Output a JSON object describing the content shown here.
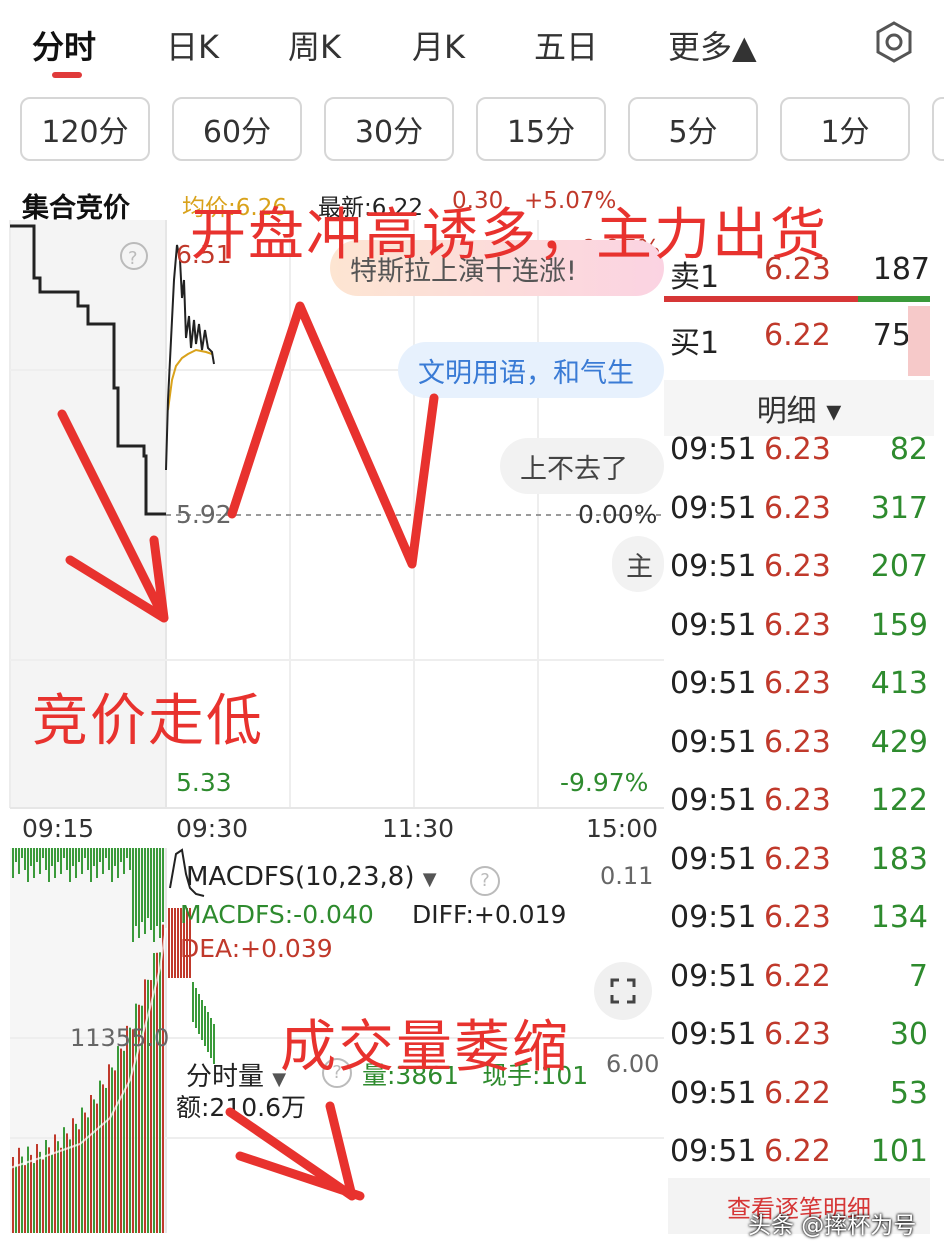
{
  "tabs": [
    "分时",
    "日K",
    "周K",
    "月K",
    "五日",
    "更多▲"
  ],
  "periods": [
    "120分",
    "60分",
    "30分",
    "15分",
    "5分",
    "1分"
  ],
  "header": {
    "auction_label": "集合竞价",
    "avg": "均价:6.26",
    "latest": "最新:6.22",
    "change": "0.30",
    "change_pct": "+5.07%"
  },
  "chart": {
    "high_price": "6.51",
    "high_pct": "+9.97%",
    "base_price": "5.92",
    "base_pct": "0.00%",
    "low_price": "5.33",
    "low_pct": "-9.97%",
    "times": [
      "09:15",
      "09:30",
      "11:30",
      "15:00"
    ]
  },
  "bubbles": [
    "特斯拉上演十连涨!",
    "文明用语，和气生",
    "上不去了",
    "主"
  ],
  "macd": {
    "title": "MACDFS(10,23,8)",
    "macdfs": "MACDFS:-0.040",
    "diff": "DIFF:+0.019",
    "dea": "DEA:+0.039",
    "right_value": "0.11"
  },
  "volume": {
    "title": "分时量",
    "volume": "量:3861",
    "hand": "现手:101",
    "amount": "额:210.6万",
    "left_value": "11355.0",
    "right_value": "6.00"
  },
  "orderbook": {
    "sell1": {
      "label": "卖1",
      "price": "6.23",
      "vol": "187"
    },
    "buy1": {
      "label": "买1",
      "price": "6.22",
      "vol": "751"
    }
  },
  "detail_title": "明细 ▾",
  "trades": [
    {
      "t": "09:51",
      "p": "6.23",
      "v": "82"
    },
    {
      "t": "09:51",
      "p": "6.23",
      "v": "317"
    },
    {
      "t": "09:51",
      "p": "6.23",
      "v": "207"
    },
    {
      "t": "09:51",
      "p": "6.23",
      "v": "159"
    },
    {
      "t": "09:51",
      "p": "6.23",
      "v": "413"
    },
    {
      "t": "09:51",
      "p": "6.23",
      "v": "429"
    },
    {
      "t": "09:51",
      "p": "6.23",
      "v": "122"
    },
    {
      "t": "09:51",
      "p": "6.23",
      "v": "183"
    },
    {
      "t": "09:51",
      "p": "6.23",
      "v": "134"
    },
    {
      "t": "09:51",
      "p": "6.22",
      "v": "7"
    },
    {
      "t": "09:51",
      "p": "6.23",
      "v": "30"
    },
    {
      "t": "09:51",
      "p": "6.22",
      "v": "53"
    },
    {
      "t": "09:51",
      "p": "6.22",
      "v": "101"
    }
  ],
  "view_all": "查看逐笔明细",
  "annotations": {
    "title": "开盘冲高诱多，主力出货",
    "auction_low": "竞价走低",
    "volume_shrink": "成交量萎缩"
  },
  "watermark": "头条 @摔杯为号",
  "colors": {
    "up": "#c0392b",
    "down": "#2e8b2e",
    "accent": "#e03a3a",
    "annotation": "#e8322e"
  }
}
